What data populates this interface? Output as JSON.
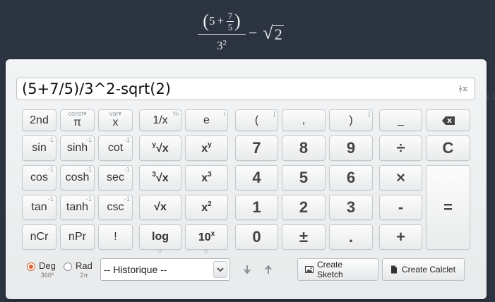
{
  "formula": {
    "outer_num_left": "5",
    "plus": "+",
    "inner_num": "7",
    "inner_den": "5",
    "den_base": "3",
    "den_exp": "2",
    "minus": "−",
    "radicand": "2"
  },
  "input": {
    "expression": "(5+7/5)/3^2-sqrt(2)"
  },
  "sci_buttons": {
    "b2nd": "2nd",
    "pi": "π",
    "pi_top": "const▾",
    "x": "x",
    "x_top": "var▾",
    "inv": "1/x",
    "inv_corner": "%",
    "e": "e",
    "e_corner": "i",
    "sin": "sin",
    "sinh": "sinh",
    "cot": "cot",
    "cos": "cos",
    "cosh": "cosh",
    "sec": "sec",
    "tan": "tan",
    "tanh": "tanh",
    "csc": "csc",
    "ncr": "nCr",
    "npr": "nPr",
    "fact": "!",
    "inv_mark": "-1",
    "yroot_pre": "y",
    "yroot": "√x",
    "xy": "x",
    "xy_sup": "y",
    "cuberoot_pre": "3",
    "cuberoot": "√x",
    "x3": "x",
    "x3_sup": "3",
    "sqrt": "√x",
    "x2": "x",
    "x2_sup": "2",
    "log": "log",
    "tenx": "10",
    "tenx_sup": "x"
  },
  "num_buttons": {
    "lparen": "(",
    "lparen_corner": "[",
    "comma": ",",
    "rparen": ")",
    "rparen_corner": "]",
    "underscore": "_",
    "seven": "7",
    "eight": "8",
    "nine": "9",
    "divide": "÷",
    "clear": "C",
    "four": "4",
    "five": "5",
    "six": "6",
    "times": "×",
    "one": "1",
    "two": "2",
    "three": "3",
    "minus": "-",
    "zero": "0",
    "plusminus": "±",
    "dot": ".",
    "plus": "+",
    "equals": "="
  },
  "angle": {
    "deg": "Deg",
    "deg_sub": "360º",
    "rad": "Rad",
    "rad_sub": "2π",
    "selected": "deg"
  },
  "history": {
    "selected": "-- Historique --"
  },
  "actions": {
    "sketch": "Create Sketch",
    "calclet": "Create Calclet"
  },
  "colors": {
    "background": "#2b3440",
    "radio_accent": "#e0622f"
  }
}
